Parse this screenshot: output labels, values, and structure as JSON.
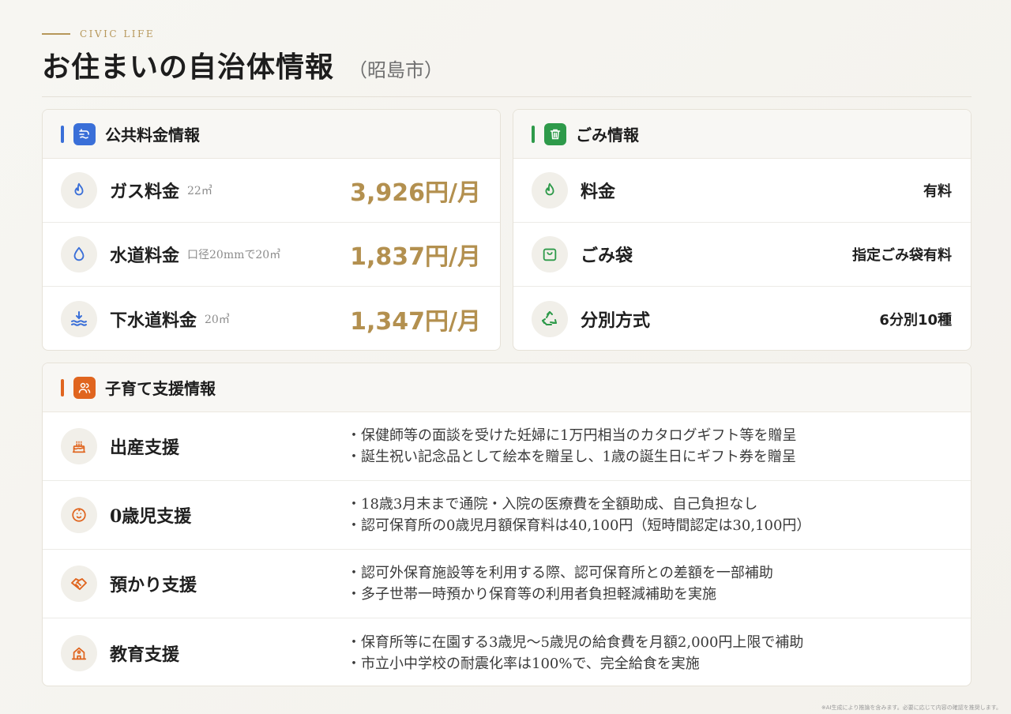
{
  "header": {
    "eyebrow": "CIVIC LIFE",
    "title": "お住まいの自治体情報",
    "subtitle": "（昭島市）"
  },
  "utilities": {
    "title": "公共料金情報",
    "accent_color": "#3a6fd8",
    "items": [
      {
        "icon": "flame-icon",
        "label": "ガス料金",
        "note": "22㎥",
        "value": "3,926円/月"
      },
      {
        "icon": "water-drop-icon",
        "label": "水道料金",
        "note": "口径20mmで20㎥",
        "value": "1,837円/月"
      },
      {
        "icon": "sewer-wave-icon",
        "label": "下水道料金",
        "note": "20㎥",
        "value": "1,347円/月"
      }
    ]
  },
  "garbage": {
    "title": "ごみ情報",
    "accent_color": "#2e9a4a",
    "items": [
      {
        "icon": "flame-icon",
        "label": "料金",
        "value": "有料"
      },
      {
        "icon": "shopping-bag-icon",
        "label": "ごみ袋",
        "value": "指定ごみ袋有料"
      },
      {
        "icon": "recycle-icon",
        "label": "分別方式",
        "value": "6分別10種"
      }
    ]
  },
  "childcare": {
    "title": "子育て支援情報",
    "accent_color": "#e0651f",
    "items": [
      {
        "icon": "cake-icon",
        "label": "出産支援",
        "lines": [
          "・保健師等の面談を受けた妊婦に1万円相当のカタログギフト等を贈呈",
          "・誕生祝い記念品として絵本を贈呈し、1歳の誕生日にギフト券を贈呈"
        ]
      },
      {
        "icon": "baby-face-icon",
        "label": "0歳児支援",
        "lines": [
          "・18歳3月末まで通院・入院の医療費を全額助成、自己負担なし",
          "・認可保育所の0歳児月額保育料は40,100円（短時間認定は30,100円）"
        ]
      },
      {
        "icon": "handshake-icon",
        "label": "預かり支援",
        "lines": [
          "・認可外保育施設等を利用する際、認可保育所との差額を一部補助",
          "・多子世帯一時預かり保育等の利用者負担軽減補助を実施"
        ]
      },
      {
        "icon": "school-icon",
        "label": "教育支援",
        "lines": [
          "・保育所等に在園する3歳児〜5歳児の給食費を月額2,000円上限で補助",
          "・市立小中学校の耐震化率は100%で、完全給食を実施"
        ]
      }
    ]
  },
  "footnote": "※AI生成により推論を含みます。必要に応じて内容の確認を推奨します。"
}
